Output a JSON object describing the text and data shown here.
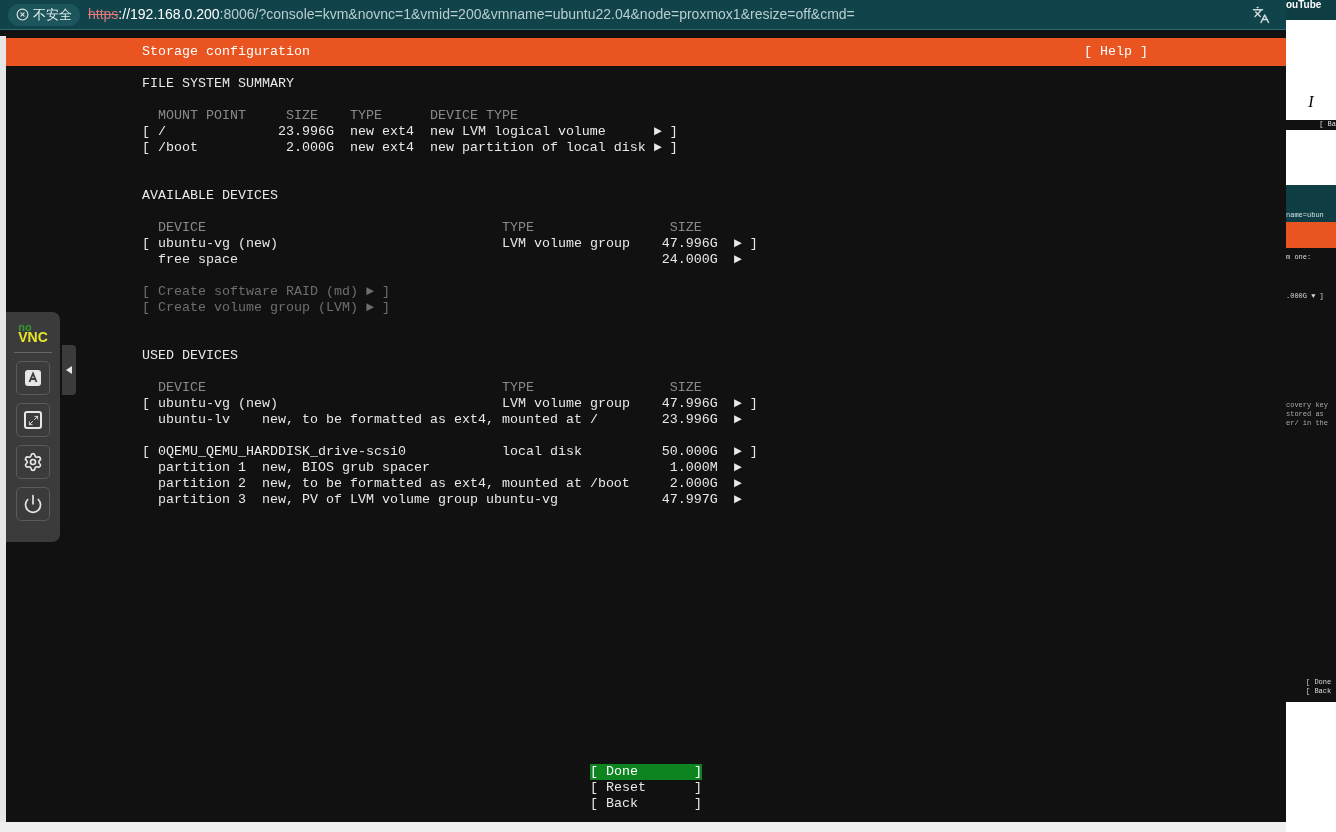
{
  "browser": {
    "security_label": "不安全",
    "url_scheme": "https",
    "url_host": "://192.168.0.200",
    "url_rest": ":8006/?console=kvm&novnc=1&vmid=200&vmname=ubuntu22.04&node=proxmox1&resize=off&cmd="
  },
  "installer": {
    "title": "Storage configuration",
    "help": "[ Help ]",
    "fs_summary": {
      "title": "FILE SYSTEM SUMMARY",
      "columns": [
        "MOUNT POINT",
        "SIZE",
        "TYPE",
        "DEVICE TYPE"
      ],
      "rows": [
        {
          "mount": "[ /",
          "size": "23.996G",
          "type": "new ext4",
          "device_type": "new LVM logical volume",
          "action": "► ]"
        },
        {
          "mount": "[ /boot",
          "size": "2.000G",
          "type": "new ext4",
          "device_type": "new partition of local disk",
          "action": "► ]"
        }
      ]
    },
    "available": {
      "title": "AVAILABLE DEVICES",
      "columns": [
        "DEVICE",
        "TYPE",
        "SIZE"
      ],
      "groups": [
        [
          {
            "kind": "device",
            "name": "[ ubuntu-vg (new)",
            "type": "LVM volume group",
            "size": "47.996G",
            "action": "► ]"
          },
          {
            "kind": "free",
            "name": "free space",
            "size": "24.000G",
            "action": "►"
          }
        ]
      ]
    },
    "create_actions": [
      {
        "text": "[ Create software RAID (md) ► ]",
        "disabled": true
      },
      {
        "text": "[ Create volume group (LVM) ► ]",
        "disabled": true
      }
    ],
    "used": {
      "title": "USED DEVICES",
      "columns": [
        "DEVICE",
        "TYPE",
        "SIZE"
      ],
      "groups": [
        [
          {
            "kind": "device",
            "name": "[ ubuntu-vg (new)",
            "type": "LVM volume group",
            "size": "47.996G",
            "action": "► ]"
          },
          {
            "kind": "partition",
            "name": "ubuntu-lv",
            "description": "new, to be formatted as ext4, mounted at /",
            "size": "23.996G",
            "action": "►"
          }
        ],
        [
          {
            "kind": "device",
            "name": "[ 0QEMU_QEMU_HARDDISK_drive-scsi0",
            "type": "local disk",
            "size": "50.000G",
            "action": "► ]"
          },
          {
            "kind": "partition",
            "name": "partition 1",
            "description": "new, BIOS grub spacer",
            "size": "1.000M",
            "action": "►"
          },
          {
            "kind": "partition",
            "name": "partition 2",
            "description": "new, to be formatted as ext4, mounted at /boot",
            "size": "2.000G",
            "action": "►"
          },
          {
            "kind": "partition",
            "name": "partition 3",
            "description": "new, PV of LVM volume group ubuntu-vg",
            "size": "47.997G",
            "action": "►"
          }
        ]
      ]
    },
    "buttons": [
      {
        "open": "[",
        "label": "Done",
        "close": "]",
        "selected": true
      },
      {
        "open": "[",
        "label": "Reset",
        "close": "]",
        "selected": false
      },
      {
        "open": "[",
        "label": "Back",
        "close": "]",
        "selected": false
      }
    ]
  },
  "novnc": {
    "logo_top": "no",
    "logo_bottom": "VNC"
  },
  "right_window": {
    "tab_text": "ouTube",
    "page_text": "I",
    "button_text": "[ Ba",
    "url_text": "name=ubun",
    "terminal_lines": [
      "m one:",
      ".000G ▼ ]"
    ],
    "notice_lines": [
      "covery key",
      "stored as",
      "er/ in the"
    ],
    "terminal_buttons": [
      "[ Done",
      "[ Back"
    ]
  }
}
